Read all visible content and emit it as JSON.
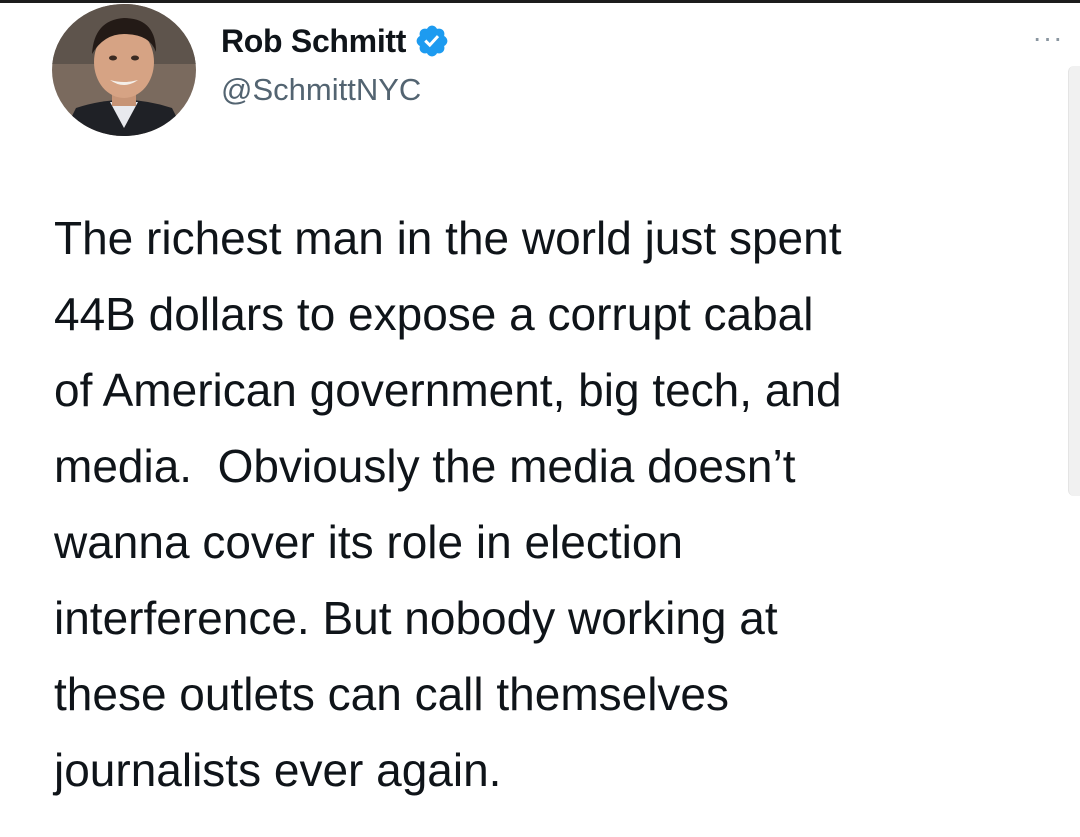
{
  "author": {
    "display_name": "Rob Schmitt",
    "handle": "@SchmittNYC",
    "verified": true,
    "avatar_icon": "user-avatar-photo"
  },
  "menu": {
    "more_label": "···"
  },
  "tweet": {
    "lines": [
      "The richest man in the world just spent",
      "44B dollars to expose a corrupt cabal",
      "of American government, big tech, and",
      "media.  Obviously the media doesn’t",
      "wanna cover its role in election",
      "interference. But nobody working at",
      "these outlets can call themselves",
      "journalists ever again."
    ]
  },
  "colors": {
    "verified_badge": "#1d9bf0",
    "text_primary": "#0f1419",
    "text_secondary": "#536471"
  }
}
